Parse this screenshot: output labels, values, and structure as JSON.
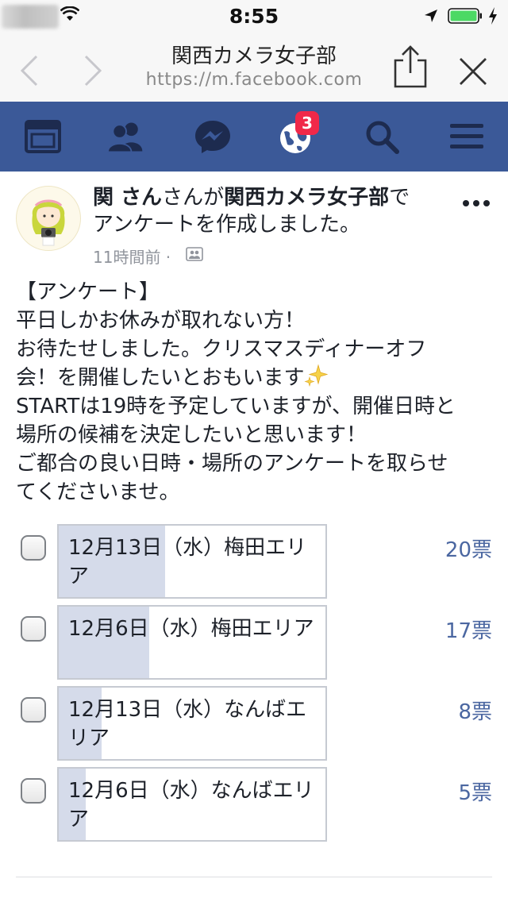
{
  "status_bar": {
    "time": "8:55"
  },
  "browser": {
    "title": "関西カメラ女子部",
    "url": "https://m.facebook.com"
  },
  "fb_nav": {
    "notification_count": "3",
    "icons": [
      "news-feed-icon",
      "friends-icon",
      "messenger-icon",
      "globe-notifications-icon",
      "search-icon",
      "menu-icon"
    ],
    "color": "#3b5998"
  },
  "post": {
    "author": "関 さん",
    "header_connector": "さんが",
    "group": "関西カメラ女子部",
    "header_tail_1": "で",
    "header_tail_2": "アンケートを作成しました。",
    "time": "11時間前 ·",
    "body_lines": [
      "【アンケート】",
      "平日しかお休みが取れない方！",
      "お待たせしました。クリスマスディナーオフ",
      "会！を開催したいとおもいます",
      "STARTは19時を予定していますが、開催日時と",
      "場所の候補を決定したいと思います！",
      "ご都合の良い日時・場所のアンケートを取らせ",
      "てくださいませ。"
    ]
  },
  "poll": {
    "options": [
      {
        "label": "12月13日（水）梅田エリア",
        "votes": "20票",
        "share": 0.4
      },
      {
        "label": "12月6日（水）梅田エリア",
        "votes": "17票",
        "share": 0.34
      },
      {
        "label": "12月13日（水）なんばエリア",
        "votes": "8票",
        "share": 0.16
      },
      {
        "label": "12月6日（水）なんばエリア",
        "votes": "5票",
        "share": 0.1
      }
    ]
  }
}
